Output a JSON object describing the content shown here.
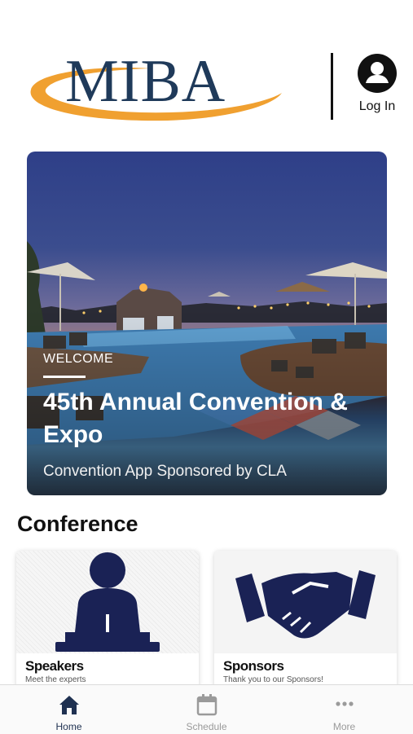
{
  "header": {
    "logo_text": "MIBA",
    "login_label": "Log In",
    "logo_swoosh_color": "#f0a030",
    "logo_text_color": "#1f3a5a"
  },
  "hero": {
    "eyebrow": "WELCOME",
    "title": "45th Annual Convention & Expo",
    "subtitle": "Convention App Sponsored by CLA"
  },
  "conference": {
    "heading": "Conference",
    "cards": [
      {
        "title": "Speakers",
        "subtitle": "Meet the experts",
        "icon": "podium-speaker-icon"
      },
      {
        "title": "Sponsors",
        "subtitle": "Thank you to our Sponsors!",
        "icon": "handshake-icon"
      }
    ]
  },
  "tabbar": {
    "tabs": [
      {
        "label": "Home",
        "icon": "home-icon",
        "active": true
      },
      {
        "label": "Schedule",
        "icon": "calendar-icon",
        "active": false
      },
      {
        "label": "More",
        "icon": "more-dots-icon",
        "active": false
      }
    ],
    "active_color": "#1f3151",
    "inactive_color": "#9a9a9a"
  }
}
